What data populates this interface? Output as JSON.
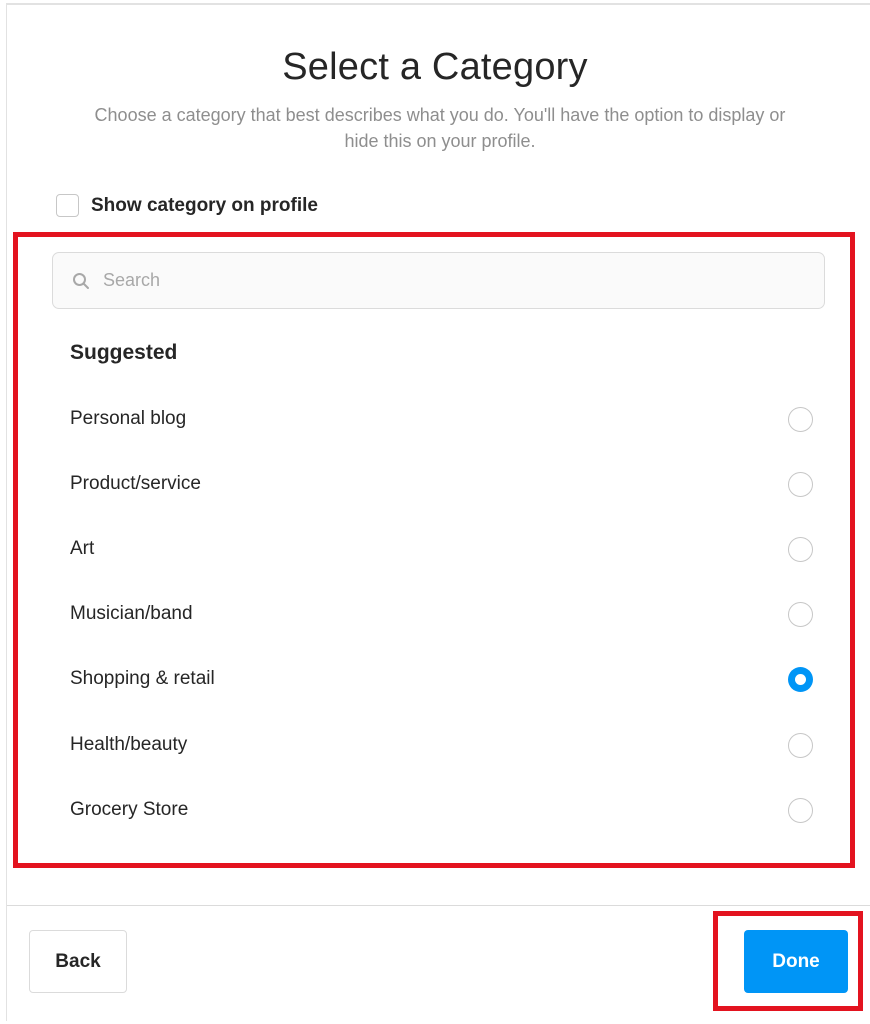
{
  "header": {
    "title": "Select a Category",
    "subtitle_line1": "Choose a category that best describes what you do. You'll have the option to display or",
    "subtitle_line2": "hide this on your profile."
  },
  "show_category": {
    "label": "Show category on profile",
    "checked": false
  },
  "search": {
    "placeholder": "Search",
    "value": "",
    "icon": "search-icon"
  },
  "suggested": {
    "title": "Suggested",
    "options": [
      {
        "label": "Personal blog",
        "selected": false
      },
      {
        "label": "Product/service",
        "selected": false
      },
      {
        "label": "Art",
        "selected": false
      },
      {
        "label": "Musician/band",
        "selected": false
      },
      {
        "label": "Shopping & retail",
        "selected": true
      },
      {
        "label": "Health/beauty",
        "selected": false
      },
      {
        "label": "Grocery Store",
        "selected": false
      }
    ]
  },
  "footer": {
    "back_label": "Back",
    "done_label": "Done"
  },
  "colors": {
    "accent": "#0095f6",
    "highlight": "#e3131f"
  }
}
